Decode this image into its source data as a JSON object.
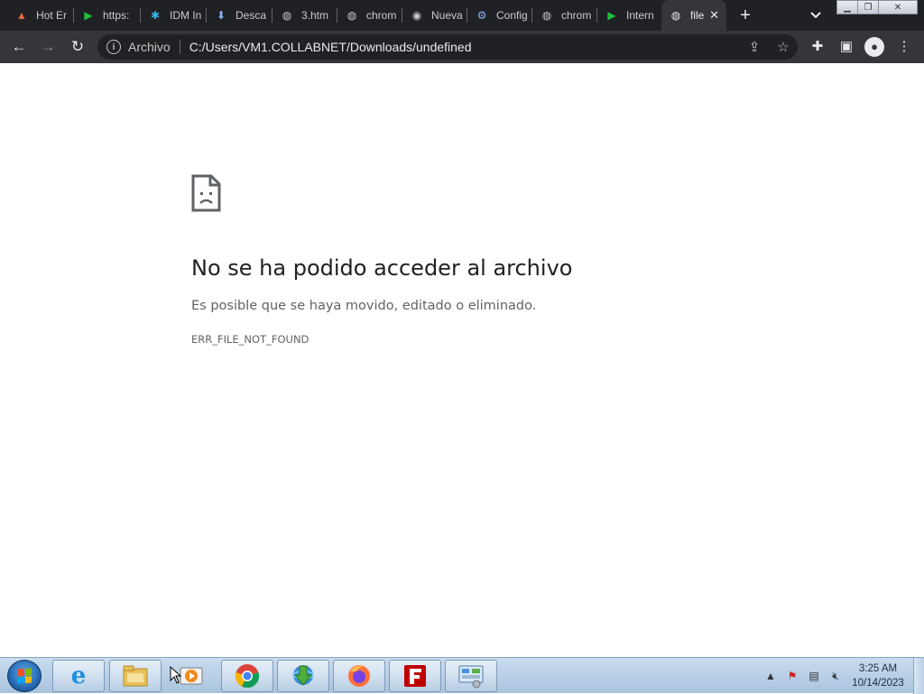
{
  "browser": {
    "tabs": [
      {
        "title": "Hot Er",
        "icon": "flame-icon",
        "active": false
      },
      {
        "title": "https:",
        "icon": "play-green-icon",
        "active": false
      },
      {
        "title": "IDM In",
        "icon": "idm-icon",
        "active": false
      },
      {
        "title": "Desca",
        "icon": "download-icon",
        "active": false
      },
      {
        "title": "3.htm",
        "icon": "globe-icon",
        "active": false
      },
      {
        "title": "chrom",
        "icon": "globe-icon",
        "active": false
      },
      {
        "title": "Nueva",
        "icon": "chrome-icon",
        "active": false
      },
      {
        "title": "Config",
        "icon": "gear-icon",
        "active": false
      },
      {
        "title": "chrom",
        "icon": "globe-icon",
        "active": false
      },
      {
        "title": "Intern",
        "icon": "play-green-icon",
        "active": false
      },
      {
        "title": "file",
        "icon": "globe-icon",
        "active": true
      }
    ],
    "address": {
      "chip": "Archivo",
      "url": "C:/Users/VM1.COLLABNET/Downloads/undefined"
    }
  },
  "error_page": {
    "title": "No se ha podido acceder al archivo",
    "description": "Es posible que se haya movido, editado o eliminado.",
    "code": "ERR_FILE_NOT_FOUND"
  },
  "taskbar": {
    "clock_time": "3:25 AM",
    "clock_date": "10/14/2023",
    "pinned": [
      "internet-explorer-icon",
      "file-explorer-icon",
      "media-player-icon",
      "chrome-icon",
      "idm-icon",
      "firefox-icon",
      "filezilla-icon",
      "control-panel-icon"
    ]
  },
  "colors": {
    "tabstrip_bg": "#202124",
    "toolbar_bg": "#35363a",
    "error_title": "#202124",
    "error_text": "#5f6368"
  }
}
